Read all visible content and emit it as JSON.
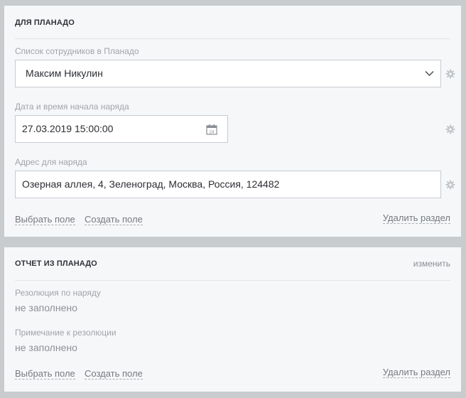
{
  "section1": {
    "title": "ДЛЯ ПЛАНАДО",
    "employee": {
      "label": "Список сотрудников в Планадо",
      "value": "Максим Никулин",
      "icon": "chevron-down-icon"
    },
    "start": {
      "label": "Дата и время начала наряда",
      "value": "27.03.2019 15:00:00",
      "calendar_day": "24",
      "icon": "calendar-icon"
    },
    "address": {
      "label": "Адрес для наряда",
      "value": "Озерная аллея, 4, Зеленоград, Москва, Россия, 124482"
    },
    "settings_icon": "gear-icon",
    "actions": {
      "choose_field": "Выбрать поле",
      "create_field": "Создать поле",
      "delete_section": "Удалить раздел"
    }
  },
  "section2": {
    "title": "ОТЧЕТ ИЗ ПЛАНАДО",
    "edit_link": "изменить",
    "resolution": {
      "label": "Резолюция по наряду",
      "value": "не заполнено"
    },
    "resolution_note": {
      "label": "Примечание к резолюции",
      "value": "не заполнено"
    },
    "actions": {
      "choose_field": "Выбрать поле",
      "create_field": "Создать поле",
      "delete_section": "Удалить раздел"
    }
  },
  "colors": {
    "page_bg": "#c9ccce",
    "panel_bg": "#f6f7f9",
    "input_border": "#c7cbd0"
  }
}
